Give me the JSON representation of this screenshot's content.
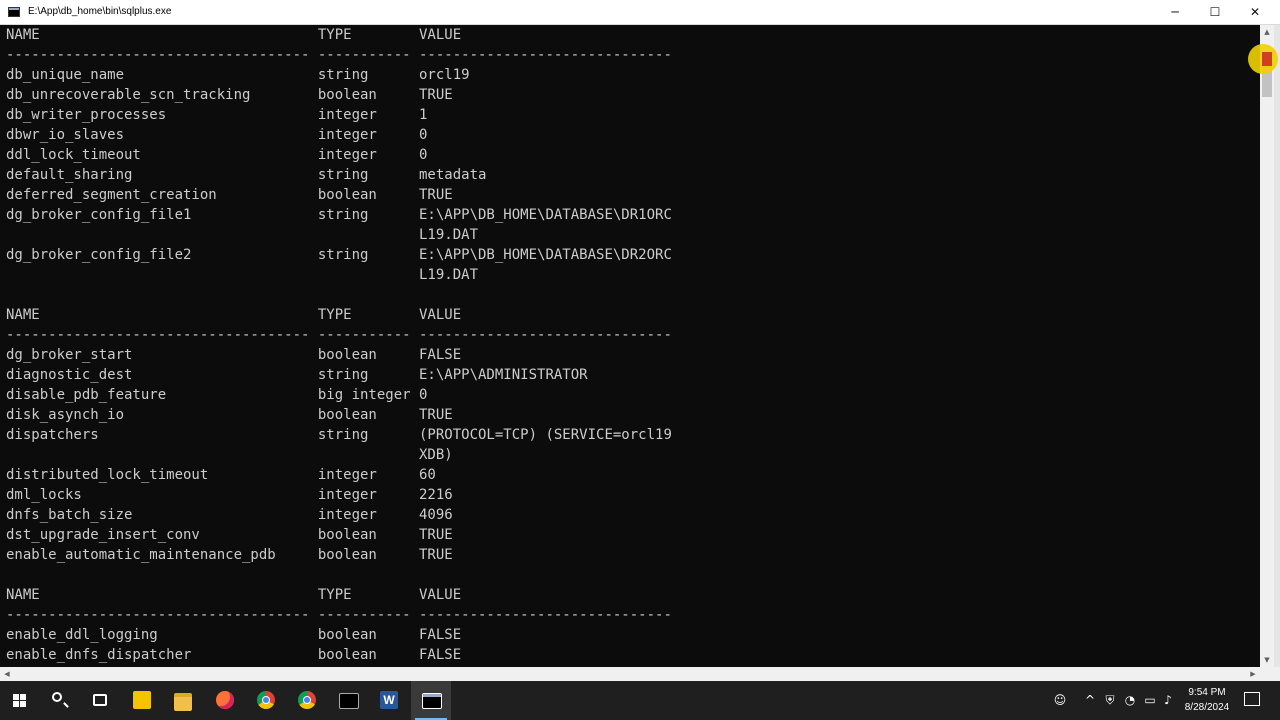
{
  "window": {
    "title": "E:\\App\\db_home\\bin\\sqlplus.exe",
    "minimize_glyph": "─",
    "maximize_glyph": "☐",
    "close_glyph": "✕"
  },
  "console": {
    "lines": [
      "NAME                                 TYPE        VALUE",
      "------------------------------------ ----------- ------------------------------",
      "db_unique_name                       string      orcl19",
      "db_unrecoverable_scn_tracking        boolean     TRUE",
      "db_writer_processes                  integer     1",
      "dbwr_io_slaves                       integer     0",
      "ddl_lock_timeout                     integer     0",
      "default_sharing                      string      metadata",
      "deferred_segment_creation            boolean     TRUE",
      "dg_broker_config_file1               string      E:\\APP\\DB_HOME\\DATABASE\\DR1ORC",
      "                                                 L19.DAT",
      "dg_broker_config_file2               string      E:\\APP\\DB_HOME\\DATABASE\\DR2ORC",
      "                                                 L19.DAT",
      "",
      "NAME                                 TYPE        VALUE",
      "------------------------------------ ----------- ------------------------------",
      "dg_broker_start                      boolean     FALSE",
      "diagnostic_dest                      string      E:\\APP\\ADMINISTRATOR",
      "disable_pdb_feature                  big integer 0",
      "disk_asynch_io                       boolean     TRUE",
      "dispatchers                          string      (PROTOCOL=TCP) (SERVICE=orcl19",
      "                                                 XDB)",
      "distributed_lock_timeout             integer     60",
      "dml_locks                            integer     2216",
      "dnfs_batch_size                      integer     4096",
      "dst_upgrade_insert_conv              boolean     TRUE",
      "enable_automatic_maintenance_pdb     boolean     TRUE",
      "",
      "NAME                                 TYPE        VALUE",
      "------------------------------------ ----------- ------------------------------",
      "enable_ddl_logging                   boolean     FALSE",
      "enable_dnfs_dispatcher               boolean     FALSE"
    ]
  },
  "scrollbars": {
    "up_glyph": "▲",
    "down_glyph": "▼",
    "left_glyph": "◀",
    "right_glyph": "▶"
  },
  "taskbar": {
    "items": [
      {
        "name": "start-button",
        "icon": "windows-logo-icon"
      },
      {
        "name": "search-button",
        "icon": "search-icon"
      },
      {
        "name": "task-view-button",
        "icon": "task-view-icon"
      },
      {
        "name": "sticky-notes-button",
        "icon": "sticky-notes-icon"
      },
      {
        "name": "file-explorer-button",
        "icon": "folder-icon"
      },
      {
        "name": "firefox-button",
        "icon": "firefox-icon"
      },
      {
        "name": "chrome-button",
        "icon": "chrome-icon"
      },
      {
        "name": "chrome-profile-button",
        "icon": "chrome-icon"
      },
      {
        "name": "command-prompt-button",
        "icon": "terminal-icon"
      },
      {
        "name": "word-button",
        "icon": "word-icon",
        "label": "W"
      },
      {
        "name": "sqlplus-button",
        "icon": "sqlplus-icon",
        "active": true
      }
    ],
    "accent_color": "#76b9ed"
  },
  "tray": {
    "people_glyph": "☺",
    "chevron_glyph": "^",
    "shield_glyph": "⛨",
    "network_glyph": "◔",
    "battery_glyph": "▭",
    "volume_glyph": "♪",
    "time": "9:54 PM",
    "date": "8/28/2024"
  }
}
